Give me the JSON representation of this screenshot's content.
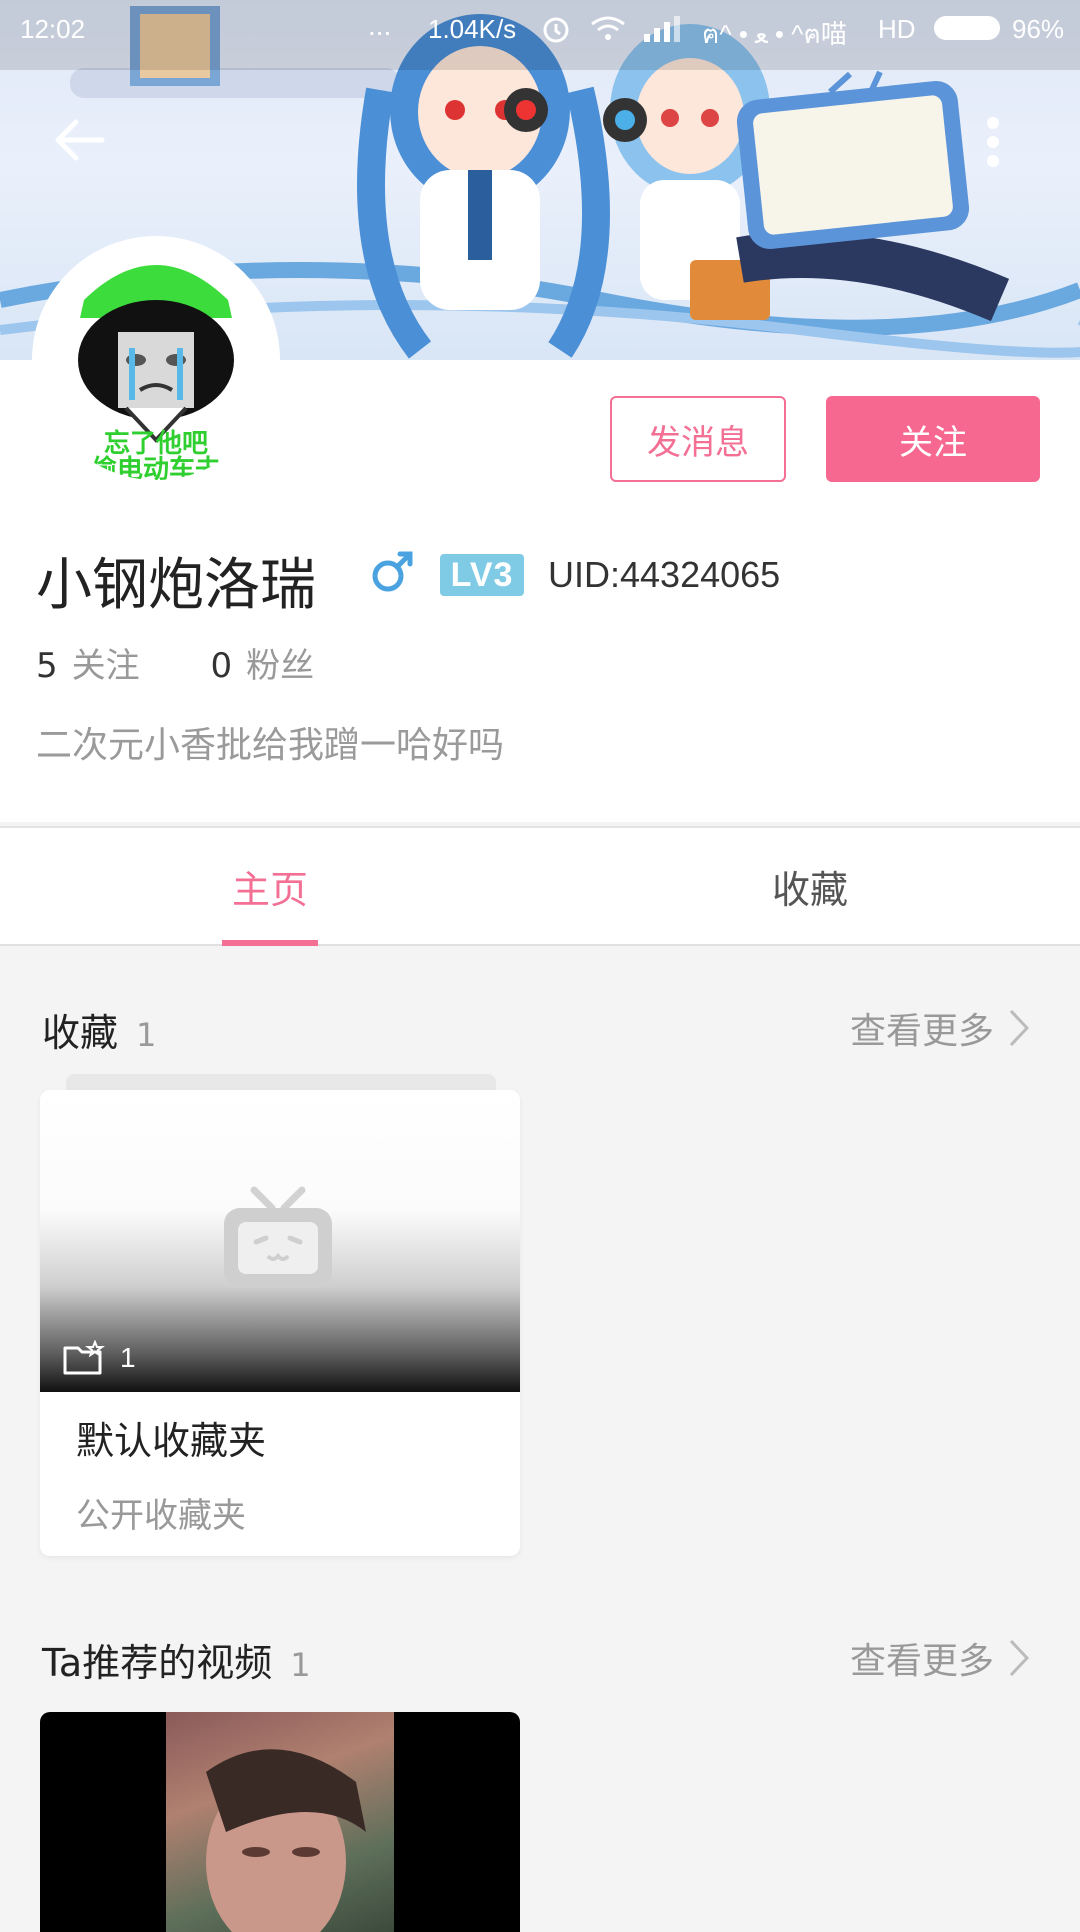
{
  "status_bar": {
    "time": "12:02",
    "dots": "...",
    "net_speed": "1.04K/s",
    "carrier": "ฅ^ • ﻌ • ^ฅ喵",
    "hd": "HD",
    "battery": "96%"
  },
  "header": {
    "back_icon": "arrow-left-icon",
    "more_icon": "more-vertical-icon"
  },
  "avatar_text": {
    "line1": "忘了他吧",
    "line2": "偷电动车去"
  },
  "actions": {
    "message_label": "发消息",
    "follow_label": "关注"
  },
  "profile": {
    "username": "小钢炮洛瑞",
    "gender": "♂",
    "level": "LV3",
    "uid": "UID:44324065",
    "following_count": "5",
    "following_label": "关注",
    "followers_count": "0",
    "followers_label": "粉丝",
    "bio": "二次元小香批给我蹭一哈好吗"
  },
  "tabs": [
    {
      "label": "主页",
      "active": true
    },
    {
      "label": "收藏",
      "active": false
    }
  ],
  "favorites_section": {
    "title": "收藏",
    "count": "1",
    "see_more": "查看更多",
    "card": {
      "item_count": "1",
      "name": "默认收藏夹",
      "subtitle": "公开收藏夹"
    }
  },
  "recommended_section": {
    "title": "Ta推荐的视频",
    "count": "1",
    "see_more": "查看更多"
  },
  "colors": {
    "accent": "#f36f94",
    "follow_bg": "#f6688f",
    "level_badge": "#7fcbe6",
    "gender": "#4aa3e0"
  }
}
